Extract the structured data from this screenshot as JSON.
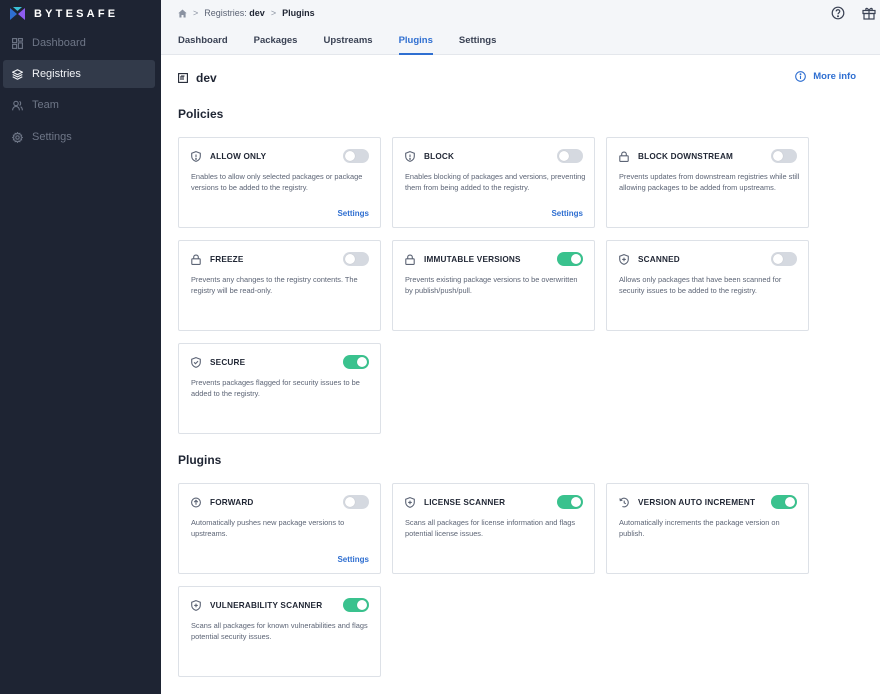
{
  "brand": {
    "name": "BYTESAFE"
  },
  "sidebar": {
    "items": [
      {
        "label": "Dashboard",
        "icon": "dashboard-icon",
        "active": false
      },
      {
        "label": "Registries",
        "icon": "layers-icon",
        "active": true
      },
      {
        "label": "Team",
        "icon": "team-icon",
        "active": false
      },
      {
        "label": "Settings",
        "icon": "gear-icon",
        "active": false
      }
    ]
  },
  "breadcrumb": {
    "registries_label": "Registries:",
    "registry_name": "dev",
    "current": "Plugins"
  },
  "tabs": [
    {
      "label": "Dashboard",
      "active": false
    },
    {
      "label": "Packages",
      "active": false
    },
    {
      "label": "Upstreams",
      "active": false
    },
    {
      "label": "Plugins",
      "active": true
    },
    {
      "label": "Settings",
      "active": false
    }
  ],
  "page": {
    "title": "dev",
    "more_info": "More info"
  },
  "policies": {
    "heading": "Policies",
    "cards": [
      {
        "title": "ALLOW ONLY",
        "icon": "shield-icon",
        "enabled": false,
        "desc": "Enables to allow only selected packages or package versions to be added to the registry.",
        "link": "Settings"
      },
      {
        "title": "BLOCK",
        "icon": "shield-icon",
        "enabled": false,
        "desc": "Enables blocking of packages and versions, preventing them from being added to the registry.",
        "link": "Settings"
      },
      {
        "title": "BLOCK DOWNSTREAM",
        "icon": "lock-icon",
        "enabled": false,
        "desc": "Prevents updates from downstream registries while still allowing packages to be added from upstreams.",
        "link": ""
      },
      {
        "title": "FREEZE",
        "icon": "lock-icon",
        "enabled": false,
        "desc": "Prevents any changes to the registry contents. The registry will be read-only.",
        "link": ""
      },
      {
        "title": "IMMUTABLE VERSIONS",
        "icon": "lock-icon",
        "enabled": true,
        "desc": "Prevents existing package versions to be overwritten by publish/push/pull.",
        "link": ""
      },
      {
        "title": "SCANNED",
        "icon": "shield-plus-icon",
        "enabled": false,
        "desc": "Allows only packages that have been scanned for security issues to be added to the registry.",
        "link": ""
      },
      {
        "title": "SECURE",
        "icon": "shield-check-icon",
        "enabled": true,
        "desc": "Prevents packages flagged for security issues to be added to the registry.",
        "link": ""
      }
    ]
  },
  "plugins": {
    "heading": "Plugins",
    "cards": [
      {
        "title": "FORWARD",
        "icon": "arrow-up-circle-icon",
        "enabled": false,
        "desc": "Automatically pushes new package versions to upstreams.",
        "link": "Settings"
      },
      {
        "title": "LICENSE SCANNER",
        "icon": "shield-plus-icon",
        "enabled": true,
        "desc": "Scans all packages for license information and flags potential license issues.",
        "link": ""
      },
      {
        "title": "VERSION AUTO INCREMENT",
        "icon": "history-icon",
        "enabled": true,
        "desc": "Automatically increments the package version on publish.",
        "link": ""
      },
      {
        "title": "VULNERABILITY SCANNER",
        "icon": "shield-plus-icon",
        "enabled": true,
        "desc": "Scans all packages for known vulnerabilities and flags potential security issues.",
        "link": ""
      }
    ]
  },
  "colors": {
    "sidebar_bg": "#1e2433",
    "accent": "#2f6fd1",
    "toggle_on": "#3ac28e",
    "toggle_off": "#d5d9e0"
  }
}
